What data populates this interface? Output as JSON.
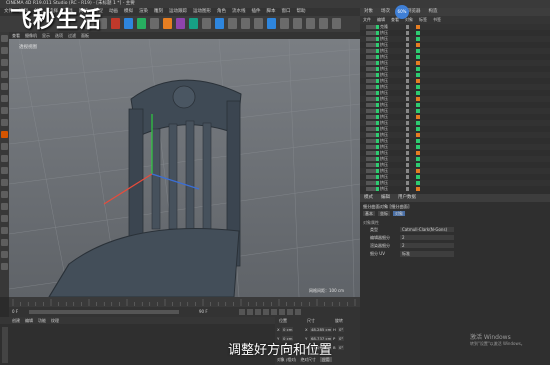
{
  "window": {
    "title": "CINEMA 4D R19.011 Studio (RC - R19) - [未标题 1 *] - 主要",
    "menus": [
      "文件",
      "编辑",
      "创建",
      "选择",
      "工具",
      "网格",
      "捕捉",
      "动画",
      "模拟",
      "渲染",
      "雕刻",
      "运动跟踪",
      "运动图形",
      "角色",
      "流水线",
      "插件",
      "脚本",
      "窗口",
      "帮助"
    ]
  },
  "brand_overlay": "飞秒生活",
  "viewport": {
    "menus": [
      "查看",
      "摄像机",
      "显示",
      "选项",
      "过滤",
      "面板"
    ],
    "label": "透视视图",
    "grid_info": "网格间距：100 cm"
  },
  "object_manager": {
    "tabs": [
      "对象",
      "场次",
      "内容浏览器",
      "构造"
    ],
    "menus": [
      "文件",
      "编辑",
      "查看",
      "对象",
      "标签",
      "书签"
    ],
    "rows": [
      "克隆",
      "挤压",
      "挤压",
      "挤压",
      "挤压",
      "挤压",
      "挤压",
      "挤压",
      "挤压",
      "挤压",
      "挤压",
      "挤压",
      "挤压",
      "挤压",
      "挤压",
      "挤压",
      "挤压",
      "挤压",
      "挤压",
      "挤压",
      "挤压",
      "挤压",
      "挤压",
      "挤压",
      "挤压",
      "挤压",
      "挤压",
      "挤压"
    ]
  },
  "attributes": {
    "tabs": [
      "模式",
      "编辑",
      "用户数据"
    ],
    "title": "细分曲面对象 [细分曲面]",
    "subtabs": [
      "基本",
      "坐标",
      "对象"
    ],
    "section": "对象属性",
    "fields": [
      {
        "label": "类型",
        "value": "Catmull-Clark(N-Gons)"
      },
      {
        "label": "编辑器细分",
        "value": "2"
      },
      {
        "label": "渲染器细分",
        "value": "2"
      },
      {
        "label": "细分 UV",
        "value": "标准"
      }
    ]
  },
  "timeline": {
    "start": "0 F",
    "end": "90 F",
    "current": "0 F"
  },
  "coords": {
    "headers": [
      "位置",
      "尺寸",
      "旋转"
    ],
    "rows": [
      [
        "X",
        "0 cm",
        "X",
        "48.285 cm",
        "H",
        "0°"
      ],
      [
        "Y",
        "0 cm",
        "Y",
        "68.737 cm",
        "P",
        "0°"
      ],
      [
        "Z",
        "0 cm",
        "Z",
        "57.077 cm",
        "B",
        "0°"
      ]
    ],
    "mode": "对象 (相对)",
    "size_mode": "绝对尺寸",
    "apply": "应用"
  },
  "material": {
    "menus": [
      "创建",
      "编辑",
      "功能",
      "纹理"
    ]
  },
  "subtitle": "调整好方向和位置",
  "watermark": {
    "line1": "激活 Windows",
    "line2": "转到\"设置\"以激活 Windows。"
  },
  "badge": "60%"
}
